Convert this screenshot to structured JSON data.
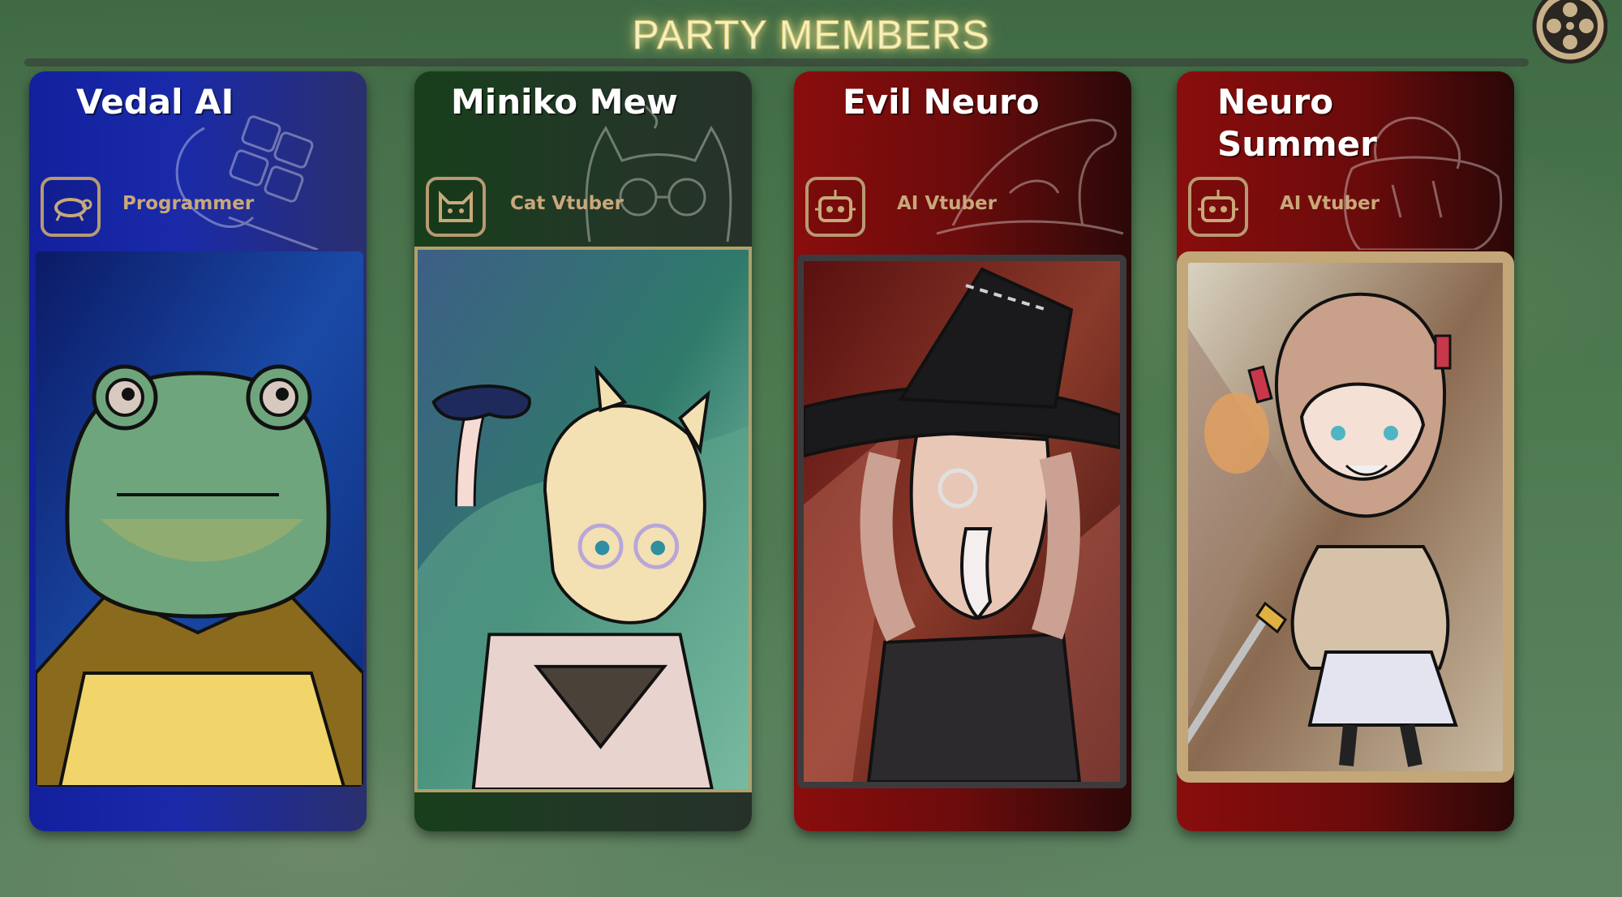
{
  "screen": {
    "title": "PARTY MEMBERS"
  },
  "settings": {
    "icon": "film-reel-icon"
  },
  "members": [
    {
      "name": "Vedal AI",
      "role": "Programmer",
      "role_icon": "turtle-icon",
      "theme": "#1a2aa8",
      "portrait": "frog-in-cloak"
    },
    {
      "name": "Miniko Mew",
      "role": "Cat Vtuber",
      "role_icon": "cat-icon",
      "theme": "#1e3f22",
      "portrait": "cat-girl-with-controller"
    },
    {
      "name": "Evil Neuro",
      "role": "AI Vtuber",
      "role_icon": "robot-icon",
      "theme": "#7a0d0d",
      "portrait": "witch-girl"
    },
    {
      "name": "Neuro\n     Summer",
      "role": "AI Vtuber",
      "role_icon": "robot-icon",
      "theme": "#7a0d0d",
      "portrait": "schoolgirl-with-sword"
    }
  ]
}
